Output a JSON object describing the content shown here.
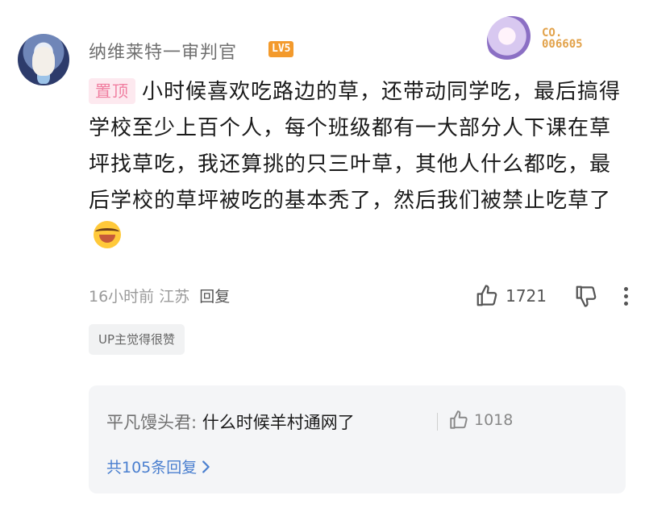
{
  "comment": {
    "username": "纳维莱特一审判官",
    "level_badge": "LV5",
    "fan_badge_no": "CO.\n006605",
    "pin_label": "置顶",
    "text": "小时候喜欢吃路边的草，还带动同学吃，最后搞得学校至少上百个人，每个班级都有一大部分人下课在草坪找草吃，我还算挑的只三叶草，其他人什么都吃，最后学校的草坪被吃的基本秃了，然后我们被禁止吃草了",
    "emoji": "laughing-crying-emoji",
    "time": "16小时前",
    "location": "江苏",
    "reply_label": "回复",
    "like_count": "1721",
    "up_tag": "UP主觉得很赞"
  },
  "replies": {
    "preview_user": "平凡馒头君:",
    "preview_text": "什么时候羊村通网了",
    "preview_like_count": "1018",
    "total_label": "共105条回复"
  },
  "colors": {
    "level_badge": "#f39a2c",
    "pin_bg": "#fde9ef",
    "pin_text": "#f07ea0",
    "link": "#4a7fcf",
    "reply_bg": "#f4f5f7"
  }
}
